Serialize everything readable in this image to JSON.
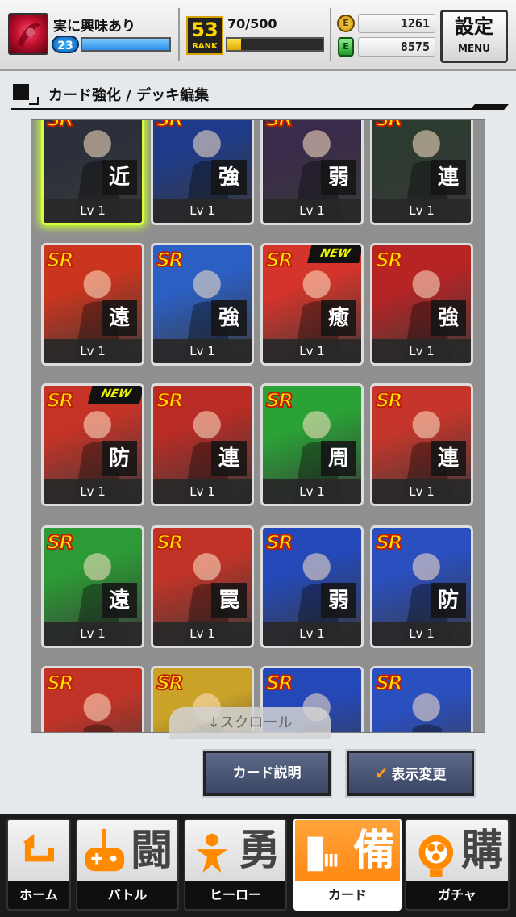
{
  "player": {
    "name": "実に興味あり",
    "level": "23",
    "exp_fraction": 1.0
  },
  "rank": {
    "number": "53",
    "label": "RANK",
    "progress_text": "70/500",
    "progress_fraction": 0.14
  },
  "currency": {
    "coins": "1261",
    "coin_icon": "E",
    "energy": "8575",
    "energy_icon": "E"
  },
  "settings": {
    "label": "設定",
    "sublabel": "MENU"
  },
  "section": {
    "title": "カード強化 / デッキ編集"
  },
  "cards": [
    {
      "rarity": "SR",
      "type": "近",
      "level": "Lv 1",
      "new": "",
      "selected": true,
      "color": "#2a2f3a"
    },
    {
      "rarity": "SR",
      "type": "強",
      "level": "Lv 1",
      "new": "",
      "selected": false,
      "color": "#1d3b8a"
    },
    {
      "rarity": "SR",
      "type": "弱",
      "level": "Lv 1",
      "new": "",
      "selected": false,
      "color": "#3a2b4a"
    },
    {
      "rarity": "SR",
      "type": "連",
      "level": "Lv 1",
      "new": "",
      "selected": false,
      "color": "#2c3a30"
    },
    {
      "rarity": "SR",
      "type": "遠",
      "level": "Lv 1",
      "new": "",
      "selected": false,
      "color": "#c9351e"
    },
    {
      "rarity": "SR",
      "type": "強",
      "level": "Lv 1",
      "new": "",
      "selected": false,
      "color": "#2b5fc4"
    },
    {
      "rarity": "SR",
      "type": "癒",
      "level": "Lv 1",
      "new": "NEW",
      "selected": false,
      "color": "#d4342a"
    },
    {
      "rarity": "SR",
      "type": "強",
      "level": "Lv 1",
      "new": "",
      "selected": false,
      "color": "#b62424"
    },
    {
      "rarity": "SR",
      "type": "防",
      "level": "Lv 1",
      "new": "NEW",
      "selected": false,
      "color": "#c43326"
    },
    {
      "rarity": "SR",
      "type": "連",
      "level": "Lv 1",
      "new": "",
      "selected": false,
      "color": "#b82c25"
    },
    {
      "rarity": "SR",
      "type": "周",
      "level": "Lv 1",
      "new": "",
      "selected": false,
      "color": "#2aa236"
    },
    {
      "rarity": "SR",
      "type": "連",
      "level": "Lv 1",
      "new": "",
      "selected": false,
      "color": "#c5352b"
    },
    {
      "rarity": "SR",
      "type": "遠",
      "level": "Lv 1",
      "new": "",
      "selected": false,
      "color": "#2c9a35"
    },
    {
      "rarity": "SR",
      "type": "罠",
      "level": "Lv 1",
      "new": "",
      "selected": false,
      "color": "#c23327"
    },
    {
      "rarity": "SR",
      "type": "弱",
      "level": "Lv 1",
      "new": "",
      "selected": false,
      "color": "#2448b8"
    },
    {
      "rarity": "SR",
      "type": "防",
      "level": "Lv 1",
      "new": "",
      "selected": false,
      "color": "#2a4fbf"
    },
    {
      "rarity": "SR",
      "type": "",
      "level": "",
      "new": "",
      "selected": false,
      "color": "#c23327"
    },
    {
      "rarity": "SR",
      "type": "",
      "level": "",
      "new": "",
      "selected": false,
      "color": "#c9a227"
    },
    {
      "rarity": "SR",
      "type": "",
      "level": "",
      "new": "",
      "selected": false,
      "color": "#2448b8"
    },
    {
      "rarity": "SR",
      "type": "",
      "level": "",
      "new": "",
      "selected": false,
      "color": "#2a4fbf"
    }
  ],
  "scroll_hint": "↓スクロール",
  "actions": {
    "card_info": "カード説明",
    "toggle_view": "表示変更"
  },
  "nav": [
    {
      "icon": "home-icon",
      "kanji": "",
      "label": "ホーム",
      "active": false
    },
    {
      "icon": "gamepad-icon",
      "kanji": "闘",
      "label": "バトル",
      "active": false
    },
    {
      "icon": "hero-icon",
      "kanji": "勇",
      "label": "ヒーロー",
      "active": false
    },
    {
      "icon": "card-icon",
      "kanji": "備",
      "label": "カード",
      "active": true
    },
    {
      "icon": "gacha-icon",
      "kanji": "購",
      "label": "ガチャ",
      "active": false
    }
  ],
  "colors": {
    "accent": "#ff8a00",
    "new_badge": "#e9f500",
    "selected_glow": "#c8ff2e"
  }
}
